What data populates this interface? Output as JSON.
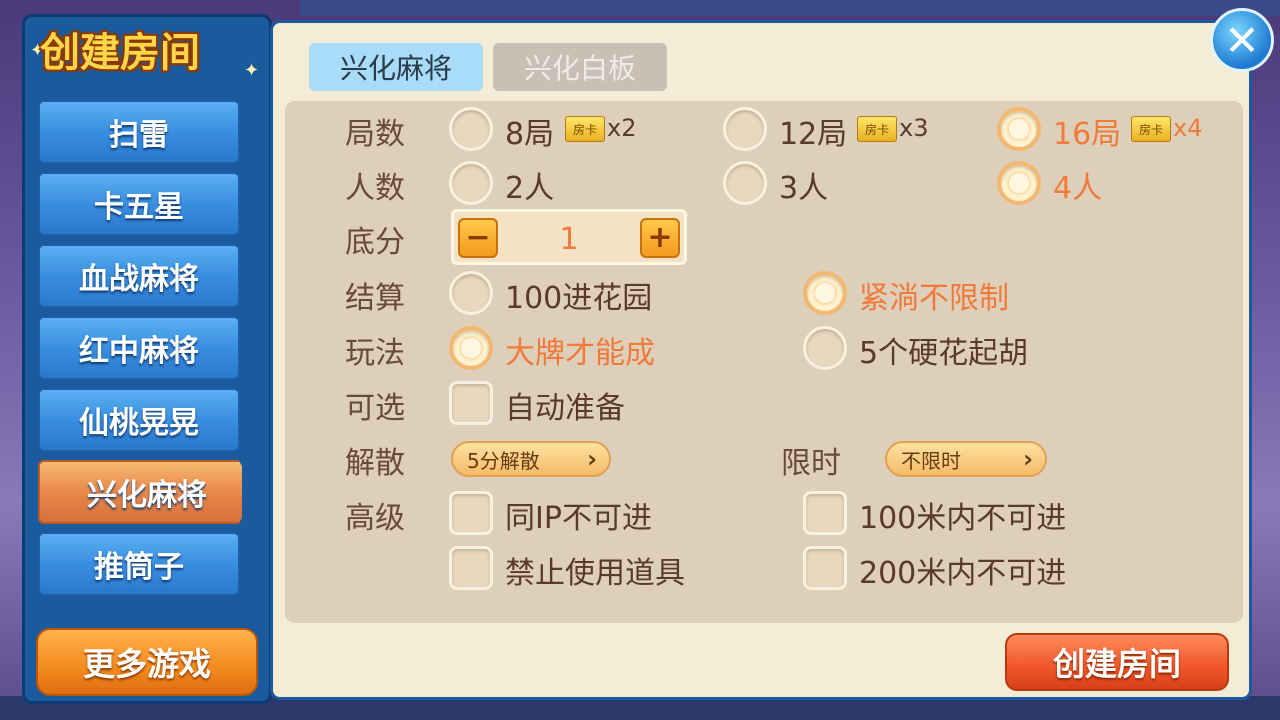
{
  "sidebar": {
    "title": "创建房间",
    "games": [
      "扫雷",
      "卡五星",
      "血战麻将",
      "红中麻将",
      "仙桃晃晃",
      "兴化麻将",
      "推筒子"
    ],
    "active_index": 5,
    "more_games": "更多游戏"
  },
  "tabs": [
    {
      "label": "兴化麻将",
      "active": true
    },
    {
      "label": "兴化白板",
      "active": false
    }
  ],
  "labels": {
    "rounds": "局数",
    "players": "人数",
    "base": "底分",
    "settle": "结算",
    "play": "玩法",
    "optional": "可选",
    "dissolve": "解散",
    "time_limit": "限时",
    "advanced": "高级"
  },
  "rounds": [
    {
      "label": "8局",
      "card": "房卡",
      "mult": "x2",
      "selected": false
    },
    {
      "label": "12局",
      "card": "房卡",
      "mult": "x3",
      "selected": false
    },
    {
      "label": "16局",
      "card": "房卡",
      "mult": "x4",
      "selected": true
    }
  ],
  "players": [
    {
      "label": "2人",
      "selected": false
    },
    {
      "label": "3人",
      "selected": false
    },
    {
      "label": "4人",
      "selected": true
    }
  ],
  "base_score": {
    "minus": "−",
    "value": "1",
    "plus": "+"
  },
  "settle": [
    {
      "label": "100进花园",
      "selected": false
    },
    {
      "label": "紧淌不限制",
      "selected": true
    }
  ],
  "play": [
    {
      "label": "大牌才能成",
      "selected": true
    },
    {
      "label": "5个硬花起胡",
      "selected": false
    }
  ],
  "optional": {
    "label": "自动准备",
    "checked": false
  },
  "dissolve": {
    "value": "5分解散"
  },
  "time_limit": {
    "value": "不限时"
  },
  "advanced": [
    {
      "label": "同IP不可进",
      "checked": false
    },
    {
      "label": "100米内不可进",
      "checked": false
    },
    {
      "label": "禁止使用道具",
      "checked": false
    },
    {
      "label": "200米内不可进",
      "checked": false
    }
  ],
  "create_button": "创建房间",
  "close_icon": "close-icon"
}
